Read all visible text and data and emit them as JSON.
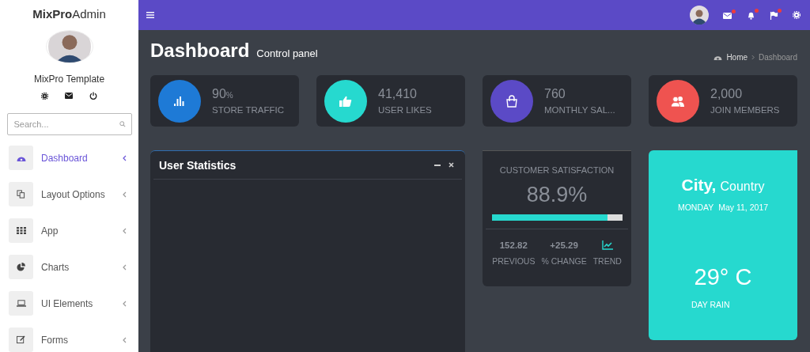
{
  "sidebar": {
    "brand": "**MixPro**Admin",
    "user_name": "MixPro Template",
    "search": {
      "placeholder": "Search..."
    },
    "items": [
      {
        "label": "Dashboard",
        "kind": "gauge",
        "selected": true
      },
      {
        "label": "Layout Options",
        "kind": "copy",
        "selected": false
      },
      {
        "label": "App",
        "kind": "grid",
        "selected": false
      },
      {
        "label": "Charts",
        "kind": "pie",
        "selected": false
      },
      {
        "label": "UI Elements",
        "kind": "laptop",
        "selected": false
      },
      {
        "label": "Forms",
        "kind": "edit",
        "selected": false
      }
    ]
  },
  "topbar": {
    "notifications": [
      {
        "kind": "mail",
        "badge": true
      },
      {
        "kind": "bell",
        "badge": true
      },
      {
        "kind": "flag",
        "badge": true
      }
    ]
  },
  "header": {
    "title": "Dashboard",
    "subtitle": "Control panel",
    "breadcrumb": [
      "Home",
      "Dashboard"
    ]
  },
  "stats": [
    {
      "value": "90",
      "unit": "%",
      "label": "STORE TRAFFIC",
      "kind": "bars",
      "color": "#1e7ad6"
    },
    {
      "value": "41,410",
      "label": "USER LIKES",
      "kind": "thumb",
      "color": "#26d9cf"
    },
    {
      "value": "760",
      "label": "MONTHLY SAL...",
      "kind": "bag",
      "color": "#5b4ac6"
    },
    {
      "value": "2,000",
      "label": "JOIN MEMBERS",
      "kind": "users",
      "color": "#ef5350"
    }
  ],
  "user_statistics": {
    "title": "User Statistics"
  },
  "satisfaction": {
    "title": "CUSTOMER SATISFACTION",
    "value": "88.9%",
    "level": 0.89,
    "metrics": [
      {
        "kind": "number",
        "value": "152.82",
        "label": "PREVIOUS"
      },
      {
        "kind": "number",
        "value": "+25.29",
        "label": "% CHANGE"
      },
      {
        "kind": "icon",
        "label": "TREND"
      }
    ]
  },
  "weather": {
    "city": "City,",
    "country": "Country",
    "day": "MONDAY",
    "date": "May 11, 2017",
    "temperature": "29° C",
    "condition": "DAY RAIN"
  }
}
